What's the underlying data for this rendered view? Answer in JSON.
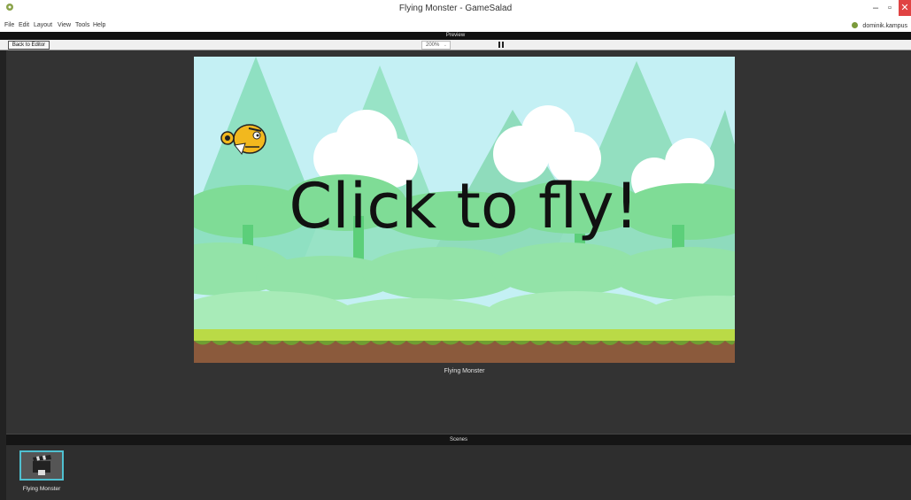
{
  "window": {
    "title": "Flying Monster - GameSalad",
    "minimize": "–",
    "maximize": "▫",
    "close": "✕"
  },
  "menu": [
    "File",
    "Edit",
    "Layout",
    "View",
    "Tools",
    "Help"
  ],
  "user": {
    "name": "dominik.kampus"
  },
  "preview": {
    "header": "Preview",
    "back_label": "Back to Editor",
    "zoom": "200%",
    "zoom_chevron": "⌄"
  },
  "game": {
    "overlay_text": "Click to fly!",
    "caption": "Flying Monster",
    "colors": {
      "sky": "#bfeff5",
      "grass": "#b8d84a",
      "dirt": "#8a5a3a",
      "tree": "#6fd887",
      "mountain": "#7dd9b0",
      "monster": "#f2b81e"
    }
  },
  "scenes": {
    "header": "Scenes",
    "items": [
      {
        "label": "Flying Monster",
        "icon": "clapperboard-icon"
      }
    ]
  },
  "colors": {
    "accent": "#4fc0d0",
    "close": "#e04343"
  }
}
